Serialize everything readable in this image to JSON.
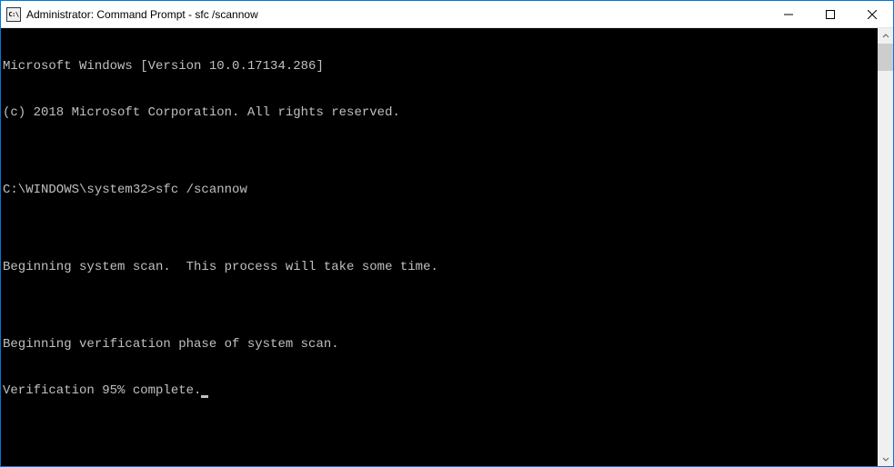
{
  "window": {
    "title": "Administrator: Command Prompt - sfc  /scannow",
    "icon_label": "C:\\"
  },
  "terminal": {
    "lines": [
      "Microsoft Windows [Version 10.0.17134.286]",
      "(c) 2018 Microsoft Corporation. All rights reserved.",
      "",
      "C:\\WINDOWS\\system32>sfc /scannow",
      "",
      "Beginning system scan.  This process will take some time.",
      "",
      "Beginning verification phase of system scan.",
      "Verification 95% complete."
    ]
  }
}
